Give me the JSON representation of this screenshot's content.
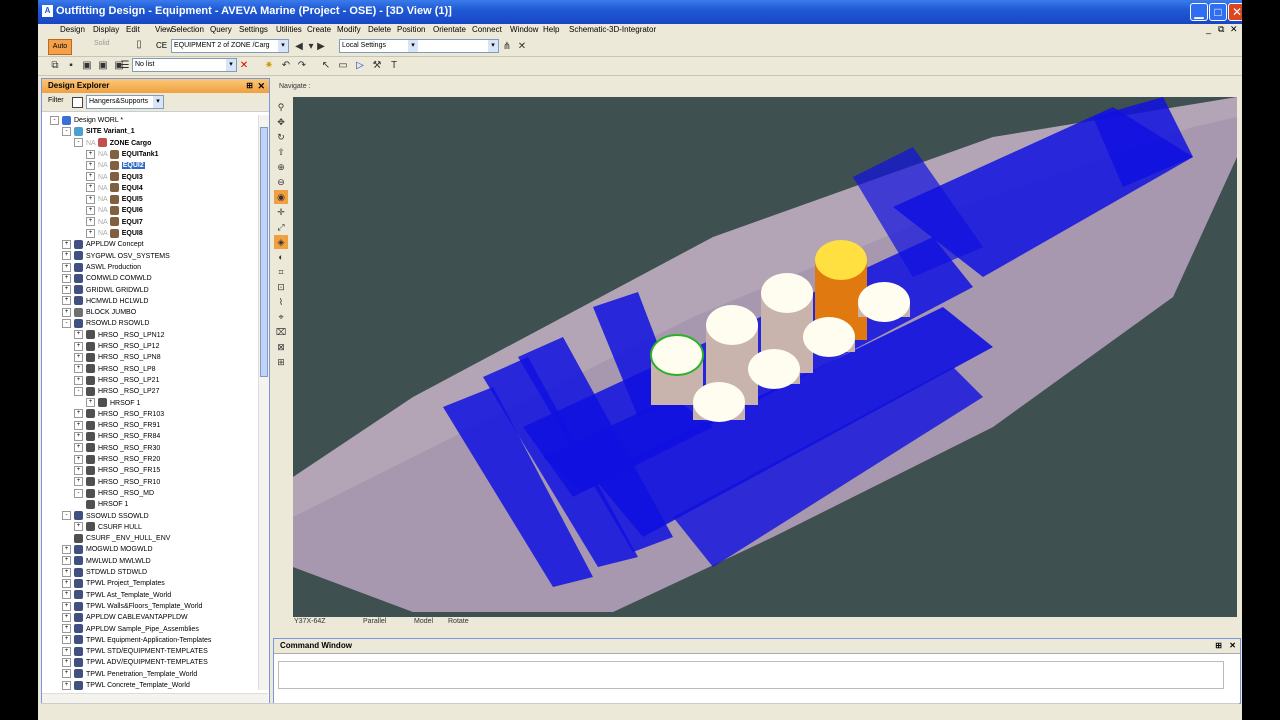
{
  "window": {
    "title": "Outfitting Design - Equipment - AVEVA Marine (Project - OSE) - [3D View (1)]",
    "min": "▁",
    "max": "□",
    "close": "✕"
  },
  "menu": {
    "items": [
      "Design",
      "Display",
      "Edit",
      "View",
      "Selection",
      "Query",
      "Settings",
      "Utilities",
      "Create",
      "Modify",
      "Delete",
      "Position",
      "Orientate",
      "Connect",
      "Window",
      "Help",
      "Schematic-3D-Integrator"
    ],
    "right_controls": [
      "_",
      "⧉",
      "✕"
    ]
  },
  "toolbar1": {
    "auto_label": "Auto",
    "solid_label": "Solid",
    "ce_label": "CE",
    "ce_value": "EQUIPMENT 2 of ZONE /Carg",
    "settings_value": "Local Settings"
  },
  "toolbar2": {
    "list_value": "No list"
  },
  "explorer": {
    "title": "Design Explorer",
    "filter_label": "Filter",
    "filter_value": "Hangers&Supports"
  },
  "tree": [
    {
      "t": "Design WORL *",
      "x": 8,
      "pm": "-",
      "c": "#3a6fd8",
      "b": false
    },
    {
      "t": "SITE Variant_1",
      "x": 20,
      "pm": "-",
      "c": "#4aa0d0",
      "b": true
    },
    {
      "t": "ZONE Cargo",
      "x": 32,
      "pm": "-",
      "c": "#c05050",
      "b": true,
      "pre": "NA"
    },
    {
      "t": "EQUITank1",
      "x": 44,
      "pm": "+",
      "c": "#806040",
      "b": true,
      "pre": "NA"
    },
    {
      "t": "EQUI2",
      "x": 44,
      "pm": "+",
      "c": "#806040",
      "b": true,
      "pre": "NA",
      "sel": true
    },
    {
      "t": "EQUI3",
      "x": 44,
      "pm": "+",
      "c": "#806040",
      "b": true,
      "pre": "NA"
    },
    {
      "t": "EQUI4",
      "x": 44,
      "pm": "+",
      "c": "#806040",
      "b": true,
      "pre": "NA"
    },
    {
      "t": "EQUI5",
      "x": 44,
      "pm": "+",
      "c": "#806040",
      "b": true,
      "pre": "NA"
    },
    {
      "t": "EQUI6",
      "x": 44,
      "pm": "+",
      "c": "#806040",
      "b": true,
      "pre": "NA"
    },
    {
      "t": "EQUI7",
      "x": 44,
      "pm": "+",
      "c": "#806040",
      "b": true,
      "pre": "NA"
    },
    {
      "t": "EQUI8",
      "x": 44,
      "pm": "+",
      "c": "#806040",
      "b": true,
      "pre": "NA"
    },
    {
      "t": "APPLDW Concept",
      "x": 20,
      "pm": "+",
      "c": "#405080",
      "b": false
    },
    {
      "t": "SYGPWL OSV_SYSTEMS",
      "x": 20,
      "pm": "+",
      "c": "#405080",
      "b": false
    },
    {
      "t": "ASWL Production",
      "x": 20,
      "pm": "+",
      "c": "#405080",
      "b": false
    },
    {
      "t": "COMWLD COMWLD",
      "x": 20,
      "pm": "+",
      "c": "#405080",
      "b": false
    },
    {
      "t": "GRIDWL GRIDWLD",
      "x": 20,
      "pm": "+",
      "c": "#405080",
      "b": false
    },
    {
      "t": "HCMWLD HCLWLD",
      "x": 20,
      "pm": "+",
      "c": "#405080",
      "b": false
    },
    {
      "t": "BLOCK JUMBO",
      "x": 20,
      "pm": "+",
      "c": "#707070",
      "b": false
    },
    {
      "t": "RSOWLD RSOWLD",
      "x": 20,
      "pm": "-",
      "c": "#405080",
      "b": false
    },
    {
      "t": "HRSO _RSO_LPN12",
      "x": 32,
      "pm": "+",
      "c": "#505050",
      "b": false
    },
    {
      "t": "HRSO _RSO_LP12",
      "x": 32,
      "pm": "+",
      "c": "#505050",
      "b": false
    },
    {
      "t": "HRSO _RSO_LPN8",
      "x": 32,
      "pm": "+",
      "c": "#505050",
      "b": false
    },
    {
      "t": "HRSO _RSO_LP8",
      "x": 32,
      "pm": "+",
      "c": "#505050",
      "b": false
    },
    {
      "t": "HRSO _RSO_LP21",
      "x": 32,
      "pm": "+",
      "c": "#505050",
      "b": false
    },
    {
      "t": "HRSO _RSO_LP27",
      "x": 32,
      "pm": "-",
      "c": "#505050",
      "b": false
    },
    {
      "t": "HRSOF 1",
      "x": 44,
      "pm": "+",
      "c": "#505050",
      "b": false
    },
    {
      "t": "HRSO _RSO_FR103",
      "x": 32,
      "pm": "+",
      "c": "#505050",
      "b": false
    },
    {
      "t": "HRSO _RSO_FR91",
      "x": 32,
      "pm": "+",
      "c": "#505050",
      "b": false
    },
    {
      "t": "HRSO _RSO_FR84",
      "x": 32,
      "pm": "+",
      "c": "#505050",
      "b": false
    },
    {
      "t": "HRSO _RSO_FR30",
      "x": 32,
      "pm": "+",
      "c": "#505050",
      "b": false
    },
    {
      "t": "HRSO _RSO_FR20",
      "x": 32,
      "pm": "+",
      "c": "#505050",
      "b": false
    },
    {
      "t": "HRSO _RSO_FR15",
      "x": 32,
      "pm": "+",
      "c": "#505050",
      "b": false
    },
    {
      "t": "HRSO _RSO_FR10",
      "x": 32,
      "pm": "+",
      "c": "#505050",
      "b": false
    },
    {
      "t": "HRSO _RSO_MD",
      "x": 32,
      "pm": "-",
      "c": "#505050",
      "b": false
    },
    {
      "t": "HRSOF 1",
      "x": 44,
      "pm": "",
      "c": "#505050",
      "b": false
    },
    {
      "t": "SSOWLD SSOWLD",
      "x": 20,
      "pm": "-",
      "c": "#405080",
      "b": false
    },
    {
      "t": "CSURF HULL",
      "x": 32,
      "pm": "+",
      "c": "#505050",
      "b": false
    },
    {
      "t": "CSURF _ENV_HULL_ENV",
      "x": 32,
      "pm": "",
      "c": "#505050",
      "b": false
    },
    {
      "t": "MOGWLD MOGWLD",
      "x": 20,
      "pm": "+",
      "c": "#405080",
      "b": false
    },
    {
      "t": "MWLWLD MWLWLD",
      "x": 20,
      "pm": "+",
      "c": "#405080",
      "b": false
    },
    {
      "t": "STDWLD STDWLD",
      "x": 20,
      "pm": "+",
      "c": "#405080",
      "b": false
    },
    {
      "t": "TPWL Project_Templates",
      "x": 20,
      "pm": "+",
      "c": "#405080",
      "b": false
    },
    {
      "t": "TPWL Ast_Template_World",
      "x": 20,
      "pm": "+",
      "c": "#405080",
      "b": false
    },
    {
      "t": "TPWL Walls&Floors_Template_World",
      "x": 20,
      "pm": "+",
      "c": "#405080",
      "b": false
    },
    {
      "t": "APPLDW CABLEVANTAPPLDW",
      "x": 20,
      "pm": "+",
      "c": "#405080",
      "b": false
    },
    {
      "t": "APPLDW Sample_Pipe_Assemblies",
      "x": 20,
      "pm": "+",
      "c": "#405080",
      "b": false
    },
    {
      "t": "TPWL Equipment-Application-Templates",
      "x": 20,
      "pm": "+",
      "c": "#405080",
      "b": false
    },
    {
      "t": "TPWL STD/EQUIPMENT-TEMPLATES",
      "x": 20,
      "pm": "+",
      "c": "#405080",
      "b": false
    },
    {
      "t": "TPWL ADV/EQUIPMENT-TEMPLATES",
      "x": 20,
      "pm": "+",
      "c": "#405080",
      "b": false
    },
    {
      "t": "TPWL Penetration_Template_World",
      "x": 20,
      "pm": "+",
      "c": "#405080",
      "b": false
    },
    {
      "t": "TPWL Concrete_Template_World",
      "x": 20,
      "pm": "+",
      "c": "#405080",
      "b": false
    }
  ],
  "view": {
    "navigate_label": "Navigate :",
    "status": [
      "Y37X-64Z",
      "Parallel",
      "Model",
      "Rotate"
    ],
    "bg_color": "#3e5050",
    "hull_color": "#c8b4c8",
    "blue_color": "#1010e0",
    "tank_color": "#fffdf0",
    "selected_tank_color": "#ffe040"
  },
  "command_window": {
    "title": "Command Window",
    "pin": "⊞",
    "close": "✕"
  }
}
